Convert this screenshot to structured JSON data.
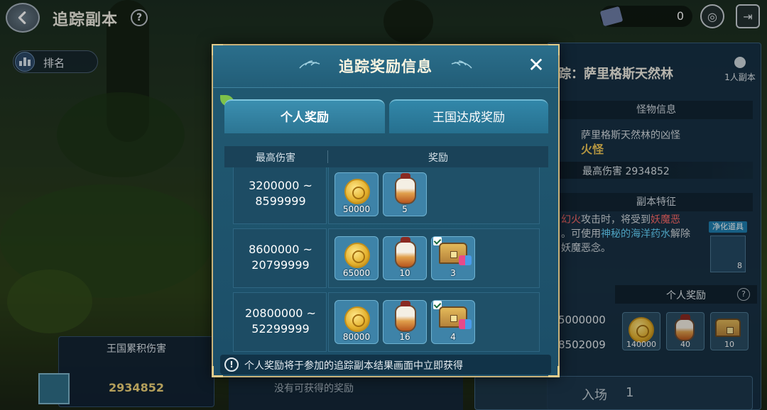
{
  "topbar": {
    "title": "追踪副本",
    "help": "?",
    "currency_amount": "0"
  },
  "left": {
    "rank_label": "排名",
    "kingdom_damage_label": "王国累积伤害",
    "kingdom_damage_value": "2934852"
  },
  "right_panel": {
    "title": "踪：萨里格斯天然林",
    "solo_label": "1人副本",
    "monster_info_label": "怪物信息",
    "monster_desc": "萨里格斯天然林的凶怪",
    "monster_name": "火怪",
    "max_damage_text": "最高伤害 2934852",
    "feature_label": "副本特征",
    "feature_line1_a": "幻火",
    "feature_line1_b": "攻击时，将受到",
    "feature_line1_c": "妖魔恶",
    "feature_line2_a": "。可使用",
    "feature_line2_b": "神秘的海洋药水",
    "feature_line2_c": "解除",
    "feature_line3": "妖魔恶念。",
    "purify_label": "净化道具",
    "purify_count": "8",
    "personal_reward_label": "个人奖励",
    "help": "?",
    "dmg_value_1": "5000000",
    "dmg_value_2": "8502009",
    "items": [
      {
        "icon": "coin-icon",
        "count": "140000"
      },
      {
        "icon": "jar-icon",
        "count": "40"
      },
      {
        "icon": "chest-icon",
        "count": "10"
      }
    ],
    "enter_label": "入场",
    "enter_count": "1"
  },
  "under_panel": {
    "no_reward_text": "没有可获得的奖励"
  },
  "modal": {
    "title": "追踪奖励信息",
    "close": "✕",
    "tabs": [
      {
        "label": "个人奖励",
        "active": true
      },
      {
        "label": "王国达成奖励",
        "active": false
      }
    ],
    "columns": {
      "damage": "最高伤害",
      "reward": "奖励"
    },
    "rows": [
      {
        "range": "3200000 ~\n8599999",
        "items": [
          {
            "icon": "coin-icon",
            "count": "50000",
            "checked": false
          },
          {
            "icon": "jar-icon",
            "count": "5",
            "checked": false
          }
        ]
      },
      {
        "range": "8600000 ~\n20799999",
        "items": [
          {
            "icon": "coin-icon",
            "count": "65000",
            "checked": false
          },
          {
            "icon": "jar-icon",
            "count": "10",
            "checked": false
          },
          {
            "icon": "chest-icon",
            "count": "3",
            "checked": true
          }
        ]
      },
      {
        "range": "20800000 ~\n52299999",
        "items": [
          {
            "icon": "coin-icon",
            "count": "80000",
            "checked": false
          },
          {
            "icon": "jar-icon",
            "count": "16",
            "checked": false
          },
          {
            "icon": "chest-icon",
            "count": "4",
            "checked": true
          }
        ]
      }
    ],
    "footer_icon": "!",
    "footer_note": "个人奖励将于参加的追踪副本结果画面中立即获得"
  },
  "colors": {
    "modal_bg": "#1c4e68",
    "modal_border": "#c9b27a",
    "gold_text": "#f0d57a",
    "monster_name": "#f2c957"
  }
}
